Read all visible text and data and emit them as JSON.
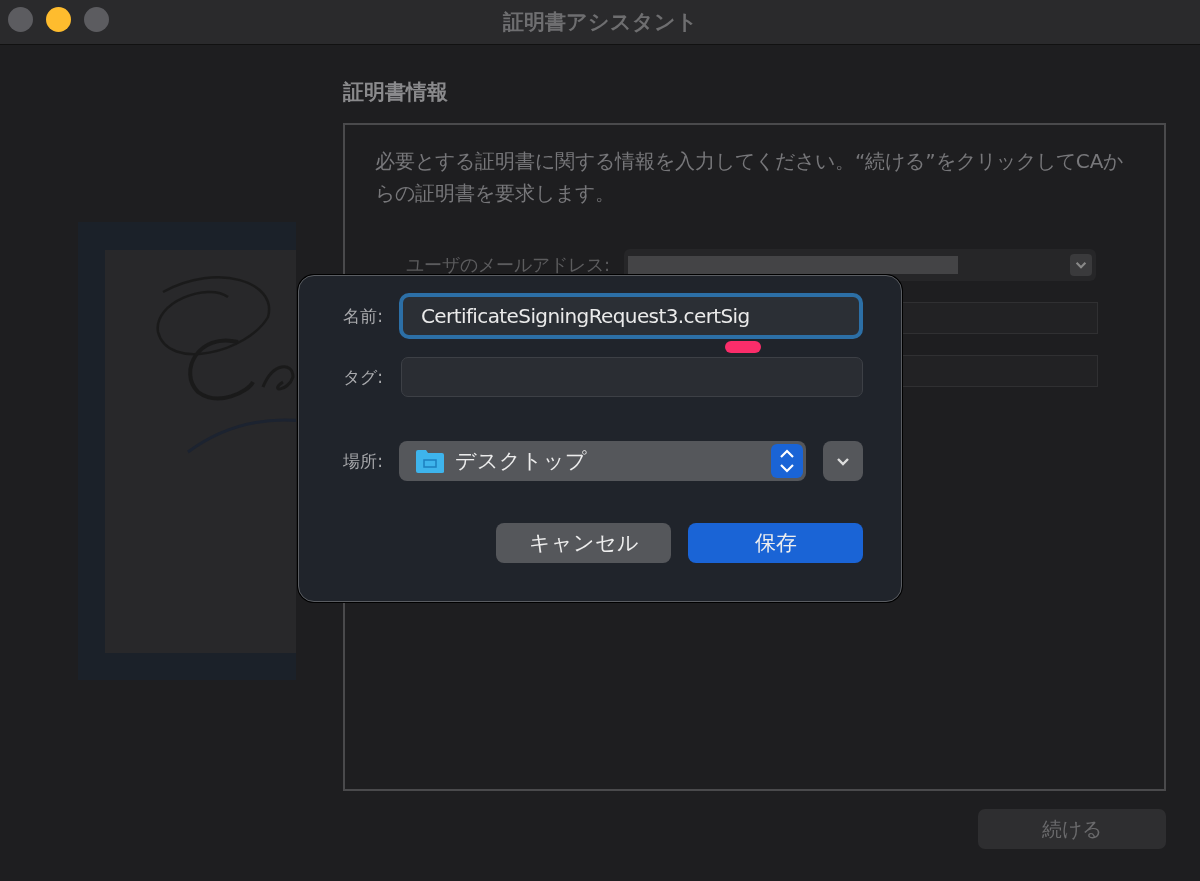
{
  "window": {
    "title": "証明書アシスタント"
  },
  "section_title": "証明書情報",
  "intro": "必要とする証明書に関する情報を入力してください。“続ける”をクリックしてCAからの証明書を要求します。",
  "form": {
    "email_label": "ユーザのメールアドレス:"
  },
  "continue_button": {
    "label": "続ける",
    "disabled": true
  },
  "save_dialog": {
    "name_label": "名前:",
    "name_value": "CertificateSigningRequest3.certSig",
    "name_focused": true,
    "tag_label": "タグ:",
    "location_label": "場所:",
    "location_value": "デスクトップ",
    "buttons": [
      {
        "label": "キャンセル",
        "kind": "secondary"
      },
      {
        "label": "保存",
        "kind": "default"
      }
    ]
  }
}
